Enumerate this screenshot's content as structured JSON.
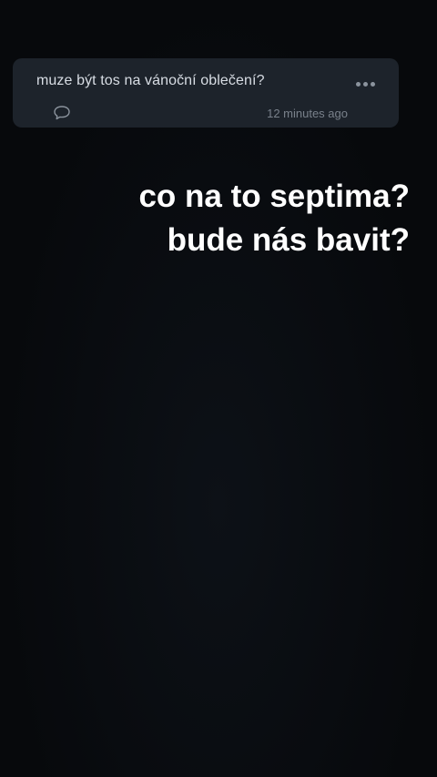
{
  "question_card": {
    "question": "muze být tos na vánoční oblečení?",
    "time_ago": "12 minutes ago",
    "more_icon": "more-horizontal-icon",
    "comment_icon": "speech-bubble-icon"
  },
  "story_text": {
    "line1": "co na to septima?",
    "line2": "bude nás bavit?",
    "color": "#ffffff"
  },
  "colors": {
    "background": "#080a0d",
    "card": "#1d232b",
    "card_text": "#d8dde4",
    "muted": "#79818b"
  }
}
